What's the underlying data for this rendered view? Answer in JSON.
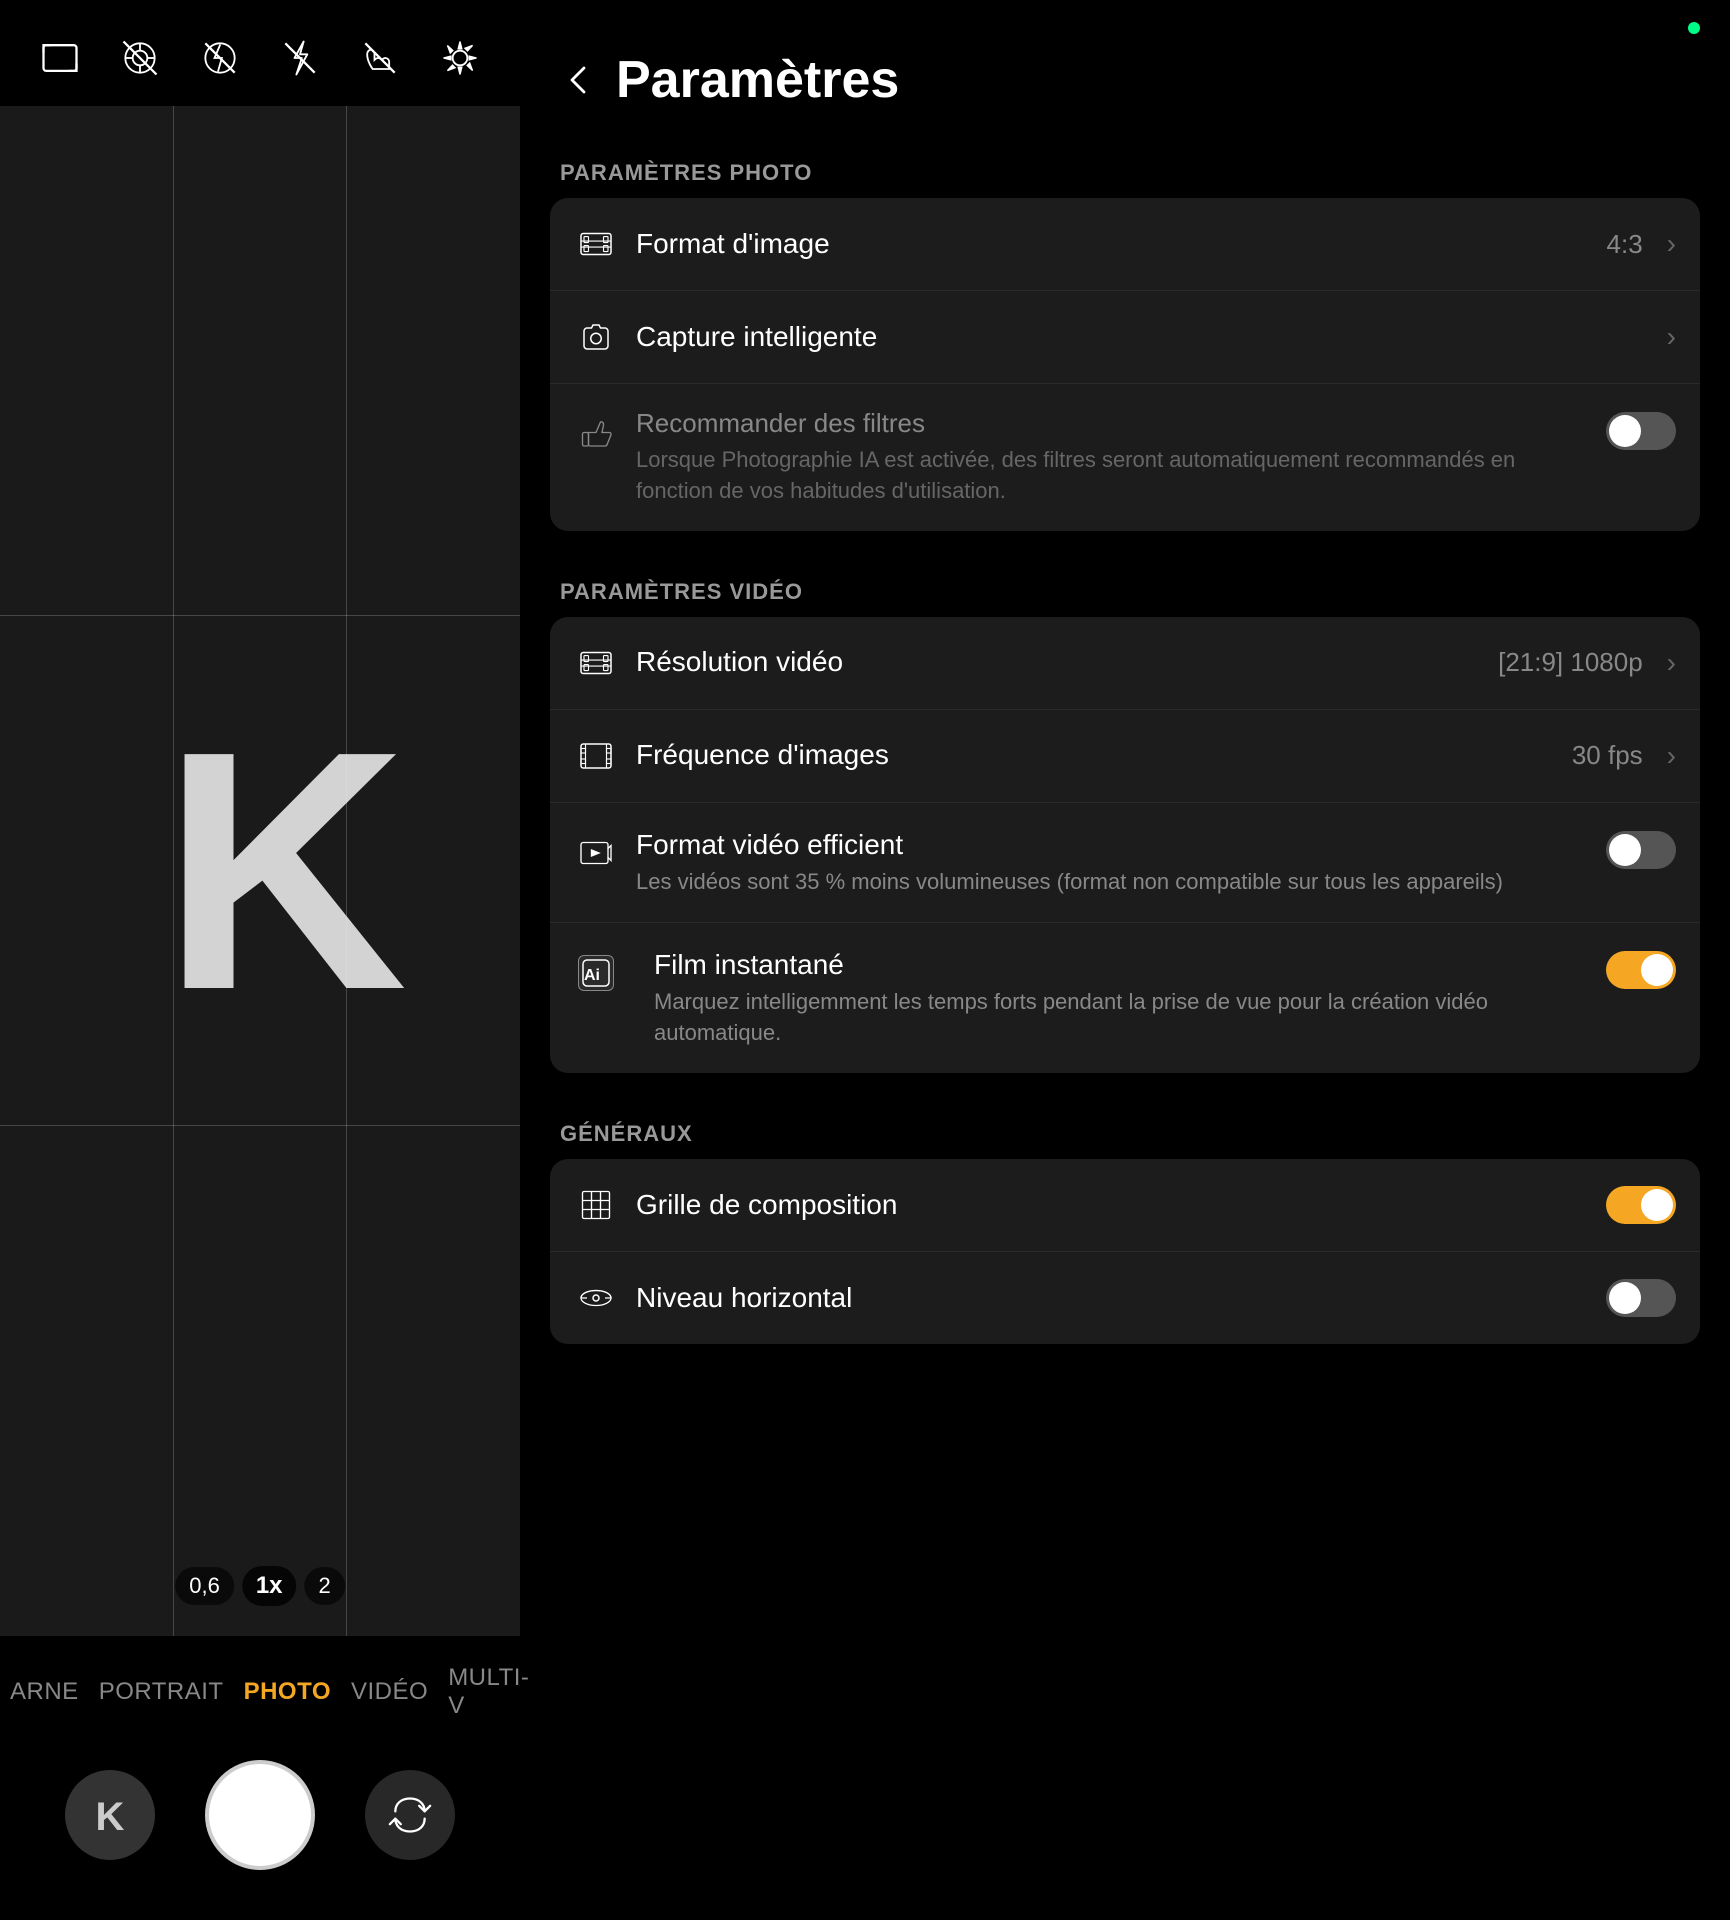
{
  "camera": {
    "status_dot_color": "#00ff88",
    "toolbar": {
      "icons": [
        "aspect-ratio-icon",
        "motion-icon",
        "no-photo-icon",
        "flash-off-icon",
        "hand-icon",
        "settings-icon"
      ]
    },
    "zoom": {
      "options": [
        "0,6",
        "1x",
        "2"
      ],
      "active": "1x"
    },
    "modes": [
      "ARNE",
      "PORTRAIT",
      "PHOTO",
      "VIDÉO",
      "MULTI-V"
    ],
    "active_mode": "PHOTO"
  },
  "settings": {
    "back_label": "←",
    "title": "Paramètres",
    "sections": [
      {
        "label": "PARAMÈTRES PHOTO",
        "items": [
          {
            "icon": "film-icon",
            "title": "Format d'image",
            "value": "4:3",
            "has_chevron": true
          },
          {
            "icon": "camera-icon",
            "title": "Capture intelligente",
            "value": "",
            "has_chevron": true
          },
          {
            "icon": "thumbs-up-icon",
            "title": "Recommander des filtres",
            "subtitle": "Lorsque Photographie IA est activée, des filtres seront automatiquement recommandés en fonction de vos habitudes d'utilisation.",
            "toggle": "off"
          }
        ]
      },
      {
        "label": "PARAMÈTRES VIDÉO",
        "items": [
          {
            "icon": "film-icon",
            "title": "Résolution vidéo",
            "value": "[21:9] 1080p",
            "has_chevron": true
          },
          {
            "icon": "film-frame-icon",
            "title": "Fréquence d'images",
            "value": "30 fps",
            "has_chevron": true
          },
          {
            "icon": "efficient-video-icon",
            "title": "Format vidéo efficient",
            "subtitle": "Les vidéos sont 35 % moins volumineuses (format non compatible sur tous les appareils)",
            "toggle": "off"
          },
          {
            "icon": "ai-icon",
            "title": "Film instantané",
            "subtitle": "Marquez intelligemment les temps forts pendant la prise de vue pour la création vidéo automatique.",
            "toggle": "on"
          }
        ]
      },
      {
        "label": "GÉNÉRAUX",
        "items": [
          {
            "icon": "grid-icon",
            "title": "Grille de composition",
            "toggle": "on"
          },
          {
            "icon": "level-icon",
            "title": "Niveau horizontal",
            "toggle": "off"
          }
        ]
      }
    ]
  }
}
